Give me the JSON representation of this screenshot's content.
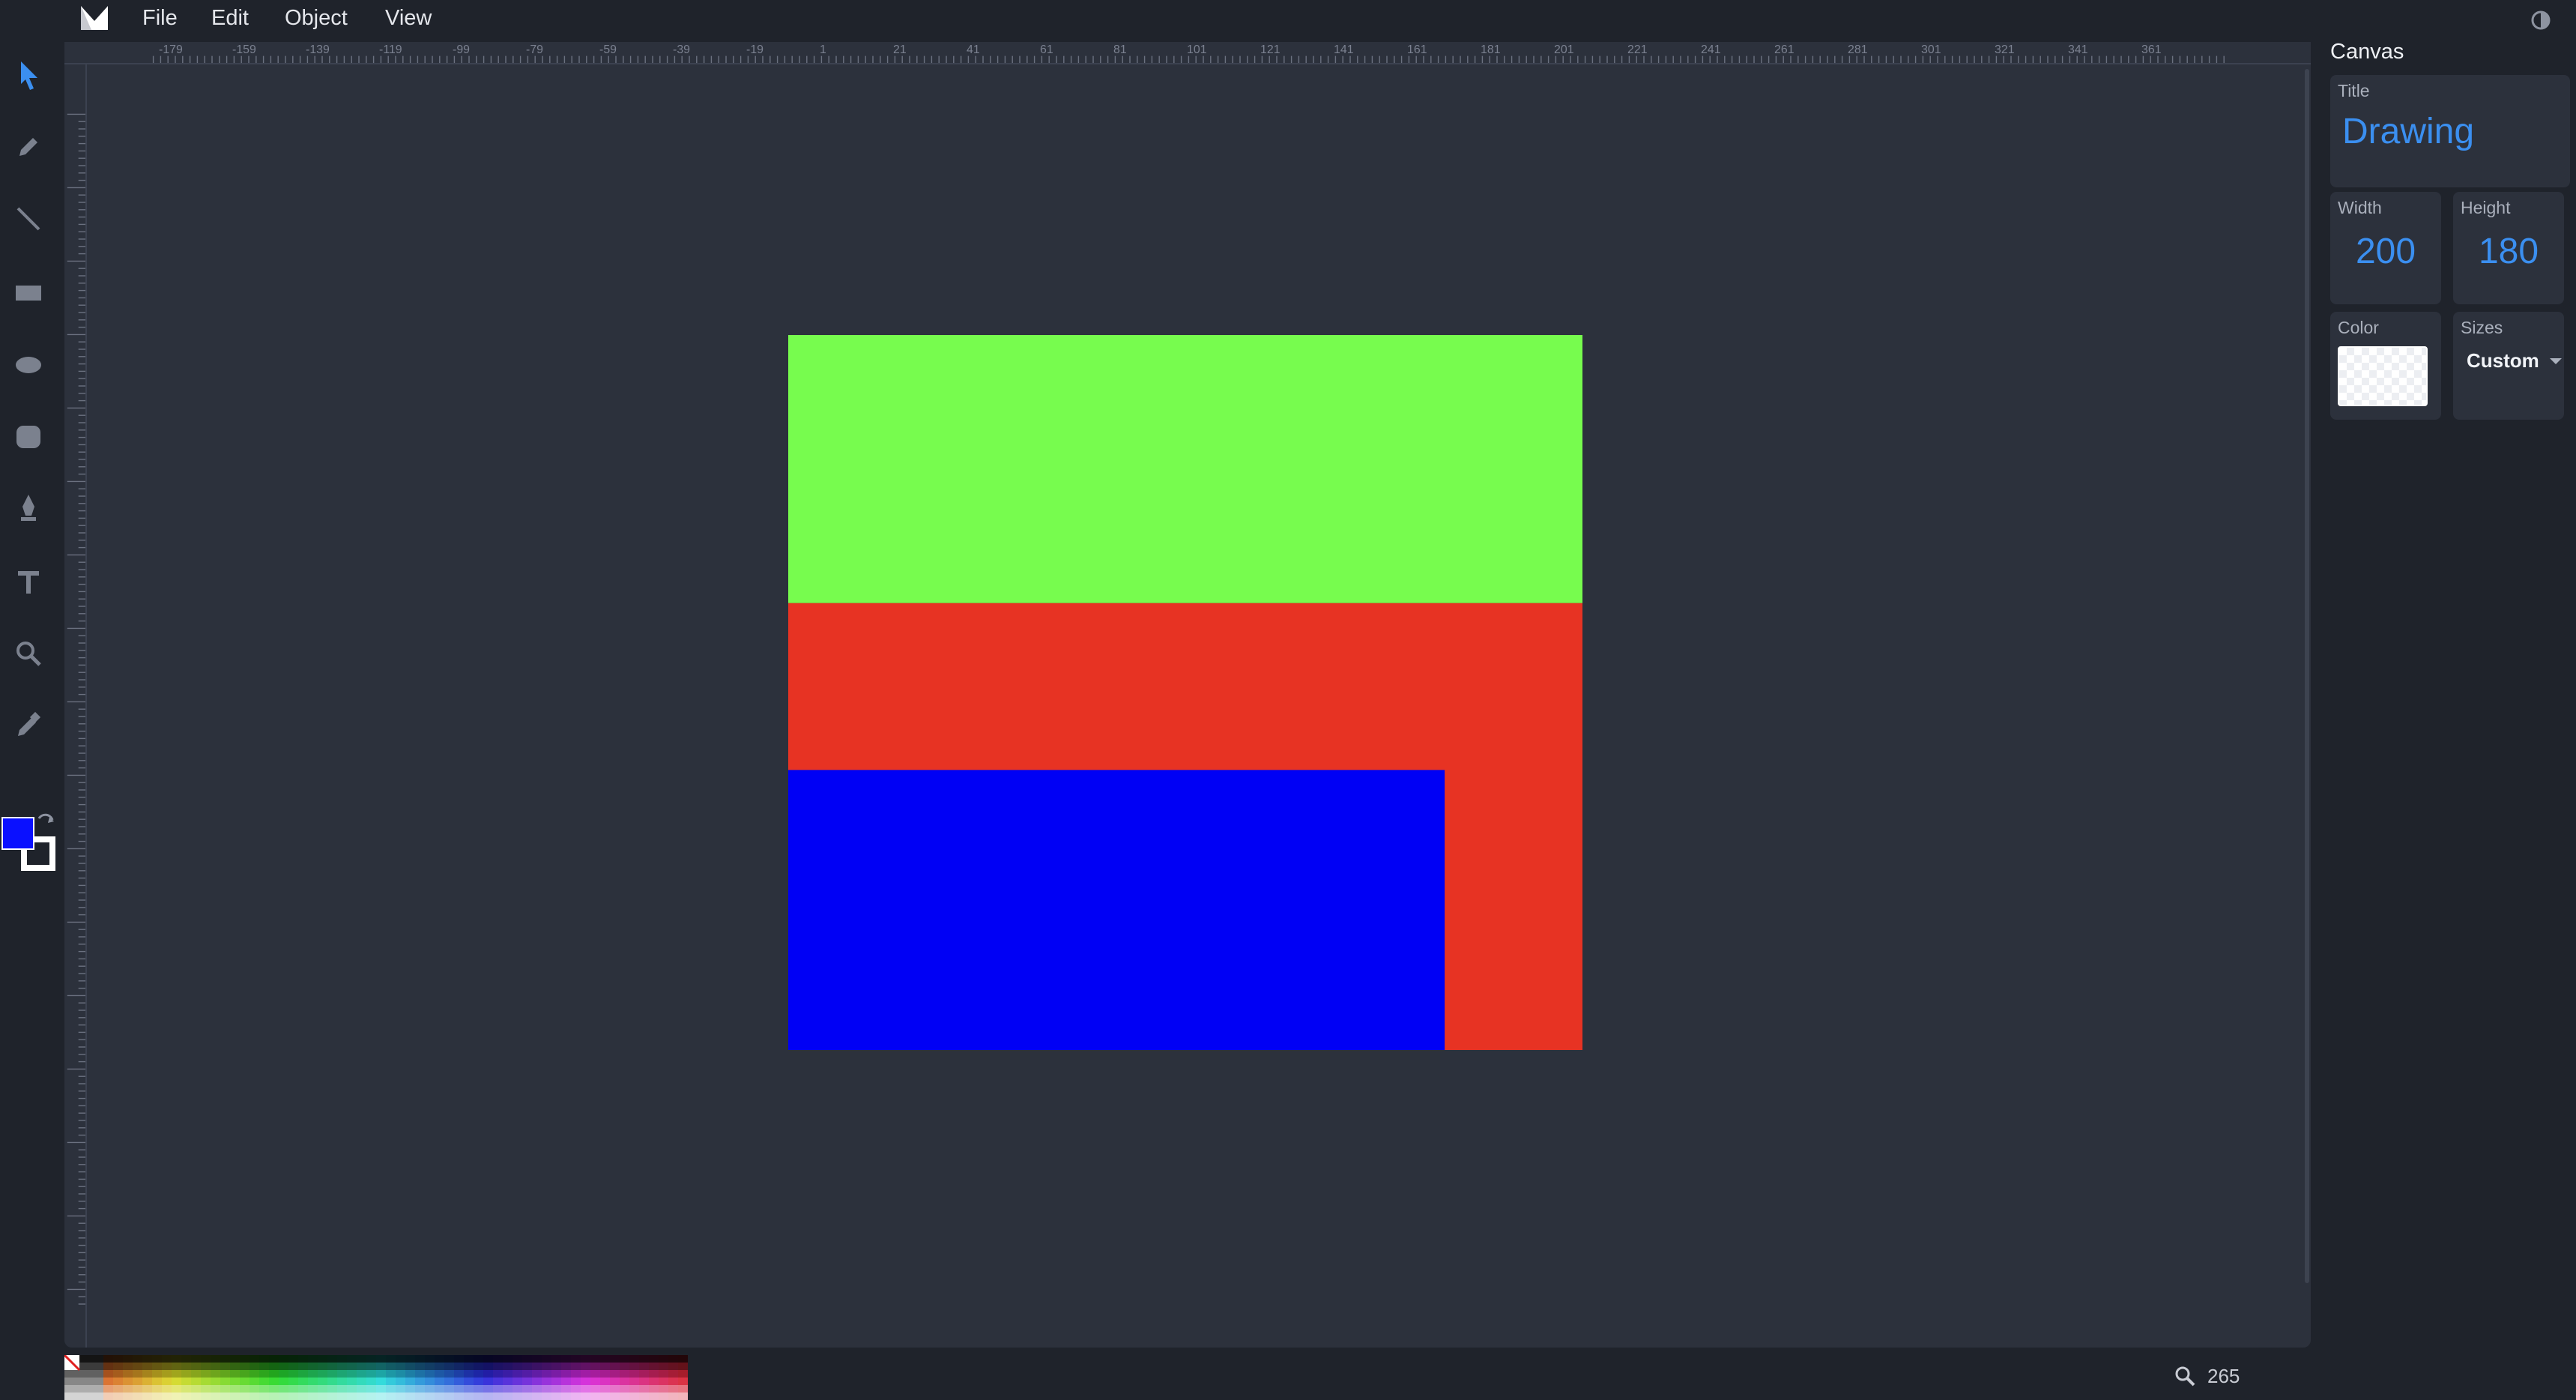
{
  "menu": {
    "items": [
      {
        "id": "file",
        "label": "File"
      },
      {
        "id": "edit",
        "label": "Edit"
      },
      {
        "id": "object",
        "label": "Object"
      },
      {
        "id": "view",
        "label": "View"
      }
    ]
  },
  "toolbar": {
    "tools": [
      "select-icon",
      "pencil-icon",
      "line-icon",
      "rectangle-icon",
      "ellipse-icon",
      "polygon-icon",
      "pen-icon",
      "text-icon",
      "zoom-icon",
      "eyedropper-icon"
    ],
    "active_tool": "select-icon",
    "fill_color": "#0a10ff",
    "stroke_color": "#ffffff"
  },
  "rulers": {
    "top_labels": [
      "-179",
      "-159",
      "-139",
      "-119",
      "-99",
      "-79",
      "-59",
      "-39",
      "-19",
      "1",
      "21",
      "41",
      "61",
      "81",
      "101",
      "121",
      "141",
      "161",
      "181",
      "201",
      "221",
      "241",
      "261",
      "281",
      "301",
      "321",
      "341",
      "361"
    ]
  },
  "canvas": {
    "shapes": [
      {
        "id": "green-rect",
        "color": "#77fc4e"
      },
      {
        "id": "red-rect",
        "color": "#e73323"
      },
      {
        "id": "blue-rect",
        "color": "#0000f5"
      }
    ]
  },
  "palette": {
    "none_swatch": "no-color-icon"
  },
  "zoom": {
    "icon": "magnifier-icon",
    "value": "265"
  },
  "panel": {
    "heading": "Canvas",
    "title_label": "Title",
    "title_value": "Drawing",
    "width_label": "Width",
    "width_value": "200",
    "height_label": "Height",
    "height_value": "180",
    "color_label": "Color",
    "sizes_label": "Sizes",
    "sizes_value": "Custom"
  },
  "colors": {
    "accent": "#3b8ff0",
    "background": "#1f232b",
    "workspace": "#2c313c"
  }
}
